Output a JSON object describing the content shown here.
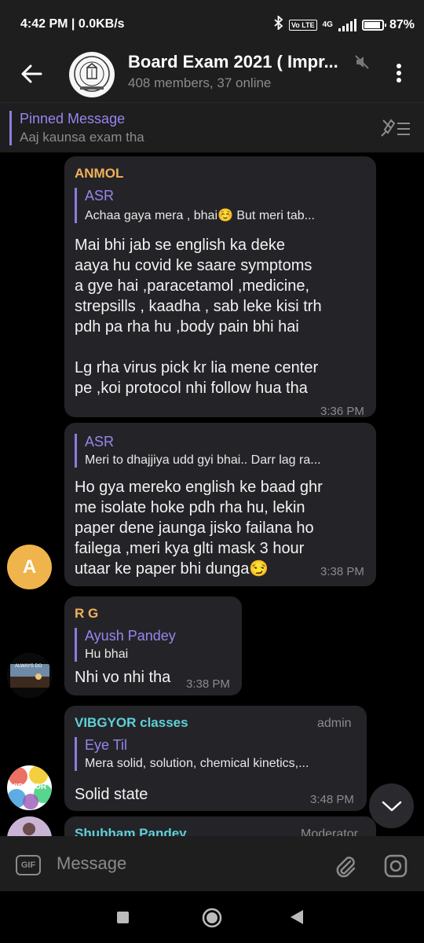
{
  "status_bar": {
    "time": "4:42 PM",
    "net_speed": "0.0KB/s",
    "volte": "Vo LTE",
    "network": "4G",
    "battery": "87%"
  },
  "header": {
    "title": "Board Exam 2021 ( Impr...",
    "subtitle": "408 members, 37 online"
  },
  "pinned": {
    "title": "Pinned Message",
    "text": "Aaj kaunsa exam tha"
  },
  "messages": [
    {
      "sender": "ANMOL",
      "sender_color": "#f2b15a",
      "reply_name": "ASR",
      "reply_text": "Achaa gaya mera , bhai☺️    But meri tab...",
      "text": "Mai bhi jab se english ka deke\naaya hu covid ke saare symptoms\na gye hai ,paracetamol ,medicine,\nstrepsills , kaadha , sab leke kisi trh\npdh pa rha hu ,body pain bhi hai\n\nLg rha virus pick kr lia mene center\npe ,koi protocol nhi follow hua tha",
      "time": "3:36 PM"
    },
    {
      "reply_name": "ASR",
      "reply_text": "Meri to dhajjiya udd gyi bhai.. Darr lag ra...",
      "text": "Ho gya mereko english ke baad ghr\nme isolate hoke pdh rha hu, lekin\npaper dene jaunga jisko failana ho\nfailega ,meri kya glti mask 3 hour\nutaar ke paper bhi dunga😏",
      "time": "3:38 PM",
      "avatar_letter": "A"
    },
    {
      "sender": "R G",
      "sender_color": "#f2b15a",
      "reply_name": "Ayush Pandey",
      "reply_text": "Hu bhai",
      "text": "Nhi vo nhi tha",
      "time": "3:38 PM",
      "avatar_caption": "ALWAYS DO"
    },
    {
      "sender": "VIBGYOR classes",
      "sender_color": "#5fd0d9",
      "role": "admin",
      "reply_name": "Eye Til",
      "reply_text": "Mera solid, solution, chemical kinetics,...",
      "text": "Solid state",
      "time": "3:48 PM",
      "avatar_caption": "VIBGYOR"
    },
    {
      "sender": "Shubham Pandey",
      "sender_color": "#5fd0d9",
      "role": "Moderator"
    }
  ],
  "input": {
    "gif_label": "GIF",
    "placeholder": "Message"
  },
  "colors": {
    "accent": "#8f7ce0",
    "bubble": "#242428",
    "bar": "#1e1e1e"
  }
}
